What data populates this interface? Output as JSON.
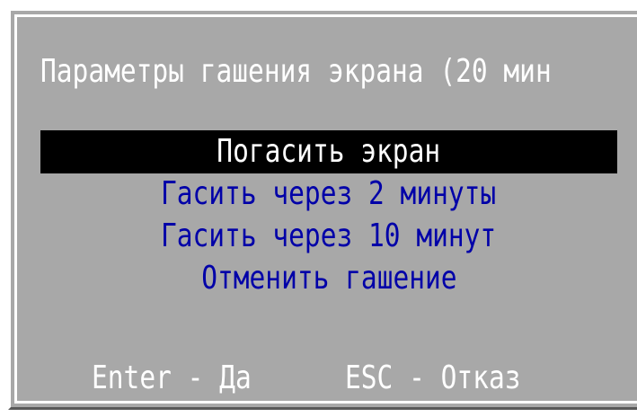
{
  "dialog": {
    "title": "Параметры гашения экрана (20 мин"
  },
  "menu": {
    "items": [
      {
        "label": "Погасить экран",
        "selected": true
      },
      {
        "label": "Гасить через 2 минуты",
        "selected": false
      },
      {
        "label": "Гасить через 10 минут",
        "selected": false
      },
      {
        "label": "Отменить гашение",
        "selected": false
      }
    ]
  },
  "hints": {
    "enter": "Enter - Да",
    "esc": "ESC - Отказ"
  },
  "colors": {
    "background": "#a8a8a8",
    "highlight_text": "#ffffff",
    "item_text": "#0000a8",
    "selection_bar": "#000000"
  }
}
